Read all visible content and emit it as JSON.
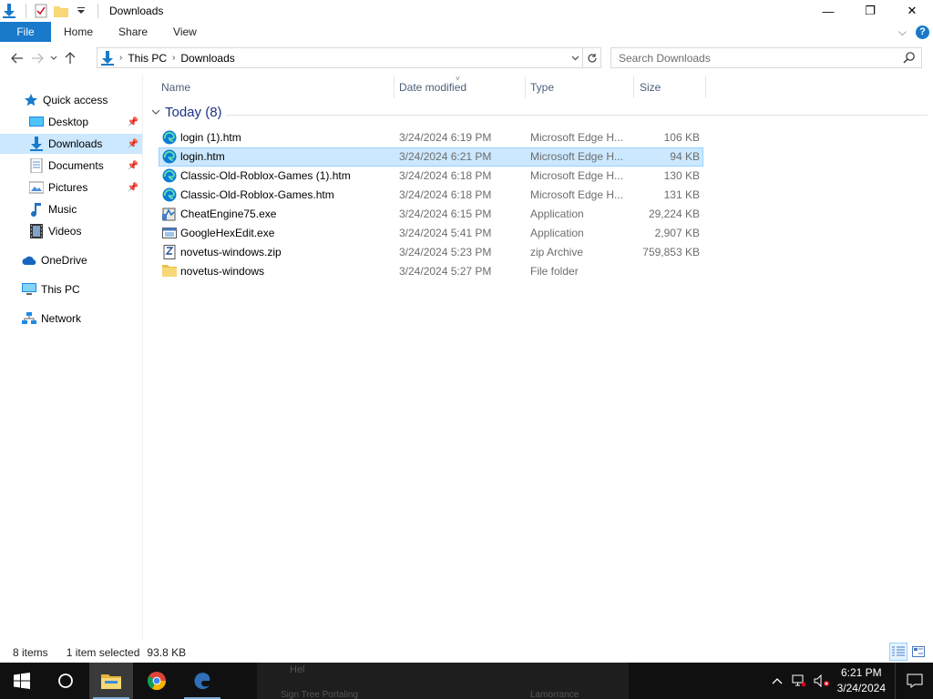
{
  "window": {
    "title": "Downloads",
    "minimize": "—",
    "restore": "❐",
    "close": "✕"
  },
  "ribbon": {
    "tabs": [
      "File",
      "Home",
      "Share",
      "View"
    ],
    "expand": "⌵",
    "help": "?"
  },
  "address": {
    "crumbs": [
      "This PC",
      "Downloads"
    ],
    "search_placeholder": "Search Downloads"
  },
  "nav": {
    "items": [
      {
        "label": "Quick access",
        "icon": "star-icon"
      },
      {
        "label": "Desktop",
        "icon": "desktop-icon",
        "pinned": true
      },
      {
        "label": "Downloads",
        "icon": "download-arrow-icon",
        "pinned": true,
        "selected": true
      },
      {
        "label": "Documents",
        "icon": "documents-icon",
        "pinned": true
      },
      {
        "label": "Pictures",
        "icon": "pictures-icon",
        "pinned": true
      },
      {
        "label": "Music",
        "icon": "music-note-icon"
      },
      {
        "label": "Videos",
        "icon": "film-icon"
      },
      {
        "label": "OneDrive",
        "icon": "cloud-icon"
      },
      {
        "label": "This PC",
        "icon": "monitor-icon"
      },
      {
        "label": "Network",
        "icon": "network-icon"
      }
    ]
  },
  "columns": {
    "name": "Name",
    "date": "Date modified",
    "type": "Type",
    "size": "Size"
  },
  "group": {
    "label": "Today (8)"
  },
  "files": [
    {
      "name": "login (1).htm",
      "date": "3/24/2024 6:19 PM",
      "type": "Microsoft Edge H...",
      "size": "106 KB",
      "icon": "edge-icon"
    },
    {
      "name": "login.htm",
      "date": "3/24/2024 6:21 PM",
      "type": "Microsoft Edge H...",
      "size": "94 KB",
      "icon": "edge-icon",
      "selected": true
    },
    {
      "name": "Classic-Old-Roblox-Games (1).htm",
      "date": "3/24/2024 6:18 PM",
      "type": "Microsoft Edge H...",
      "size": "130 KB",
      "icon": "edge-icon"
    },
    {
      "name": "Classic-Old-Roblox-Games.htm",
      "date": "3/24/2024 6:18 PM",
      "type": "Microsoft Edge H...",
      "size": "131 KB",
      "icon": "edge-icon"
    },
    {
      "name": "CheatEngine75.exe",
      "date": "3/24/2024 6:15 PM",
      "type": "Application",
      "size": "29,224 KB",
      "icon": "installer-icon"
    },
    {
      "name": "GoogleHexEdit.exe",
      "date": "3/24/2024 5:41 PM",
      "type": "Application",
      "size": "2,907 KB",
      "icon": "application-icon"
    },
    {
      "name": "novetus-windows.zip",
      "date": "3/24/2024 5:23 PM",
      "type": "zip Archive",
      "size": "759,853 KB",
      "icon": "zip-icon"
    },
    {
      "name": "novetus-windows",
      "date": "3/24/2024 5:27 PM",
      "type": "File folder",
      "size": "",
      "icon": "folder-icon"
    }
  ],
  "status": {
    "count": "8 items",
    "selection": "1 item selected",
    "size": "93.8 KB"
  },
  "taskbar": {
    "time": "6:21 PM",
    "date": "3/24/2024",
    "ghost_text_1": "Hel",
    "ghost_text_2": "Sign Tree Portaling",
    "ghost_text_3": "Lamorrance"
  },
  "colors": {
    "accent": "#1979ca",
    "selection": "#cce8ff",
    "group": "#1e3287",
    "taskbar": "#101010"
  }
}
